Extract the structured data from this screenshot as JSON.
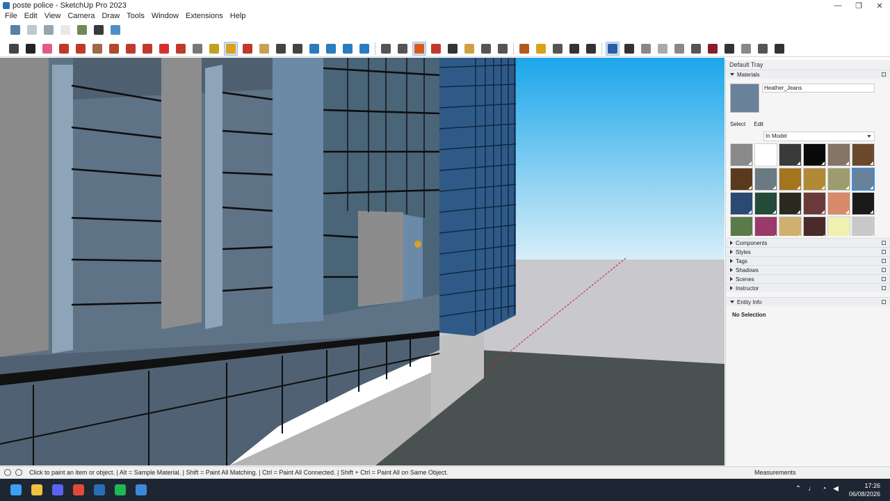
{
  "window": {
    "title": "poste police - SketchUp Pro 2023",
    "controls": [
      "—",
      "❐",
      "✕"
    ]
  },
  "menu": [
    "File",
    "Edit",
    "View",
    "Camera",
    "Draw",
    "Tools",
    "Window",
    "Extensions",
    "Help"
  ],
  "toolbar1": [
    {
      "name": "iso-view-icon",
      "color": "#5a7fa8"
    },
    {
      "name": "wireframe-style-icon",
      "color": "#bfc7cf"
    },
    {
      "name": "hidden-line-style-icon",
      "color": "#9aa4ad"
    },
    {
      "name": "shaded-style-icon",
      "color": "#e8e8e8"
    },
    {
      "name": "textured-style-icon",
      "color": "#6f8a52"
    },
    {
      "name": "monochrome-style-icon",
      "color": "#3a3a3a"
    },
    {
      "name": "xray-style-icon",
      "color": "#4d8fc8"
    }
  ],
  "toolbar2": [
    {
      "name": "zoom-extents-icon",
      "color": "#444"
    },
    {
      "name": "select-tool-icon",
      "color": "#222"
    },
    {
      "name": "eraser-tool-icon",
      "color": "#e05a8a"
    },
    {
      "name": "line-tool-icon",
      "color": "#c0392b"
    },
    {
      "name": "arc-tool-icon",
      "color": "#c0392b"
    },
    {
      "name": "rectangle-tool-icon",
      "color": "#a06a4a"
    },
    {
      "name": "push-pull-tool-icon",
      "color": "#b04a2a"
    },
    {
      "name": "offset-tool-icon",
      "color": "#c0392b"
    },
    {
      "name": "move-tool-icon",
      "color": "#c0392b"
    },
    {
      "name": "rotate-tool-icon",
      "color": "#d43030"
    },
    {
      "name": "scale-tool-icon",
      "color": "#c0392b"
    },
    {
      "name": "follow-me-tool-icon",
      "color": "#777"
    },
    {
      "name": "tape-measure-icon",
      "color": "#c4a020"
    },
    {
      "name": "paint-bucket-icon",
      "color": "#d8a21c",
      "active": true
    },
    {
      "name": "orbit-tool-icon",
      "color": "#c0392b"
    },
    {
      "name": "pan-tool-icon",
      "color": "#c9a05a"
    },
    {
      "name": "zoom-tool-icon",
      "color": "#444"
    },
    {
      "name": "zoom-window-icon",
      "color": "#444"
    },
    {
      "name": "section-plane-icon",
      "color": "#2a7bbf"
    },
    {
      "name": "sandbox-icon",
      "color": "#2a7bbf"
    },
    {
      "name": "layers-icon",
      "color": "#2a7bbf"
    },
    {
      "name": "solid-tools-icon",
      "color": "#2a7bbf"
    },
    {
      "name": "account-icon",
      "color": "#555"
    },
    {
      "name": "warehouse-icon",
      "color": "#555"
    },
    {
      "name": "share-component-icon",
      "color": "#d85a1a",
      "active": true
    },
    {
      "name": "extension-warehouse-icon",
      "color": "#c0392b"
    },
    {
      "name": "add-location-icon",
      "color": "#333"
    },
    {
      "name": "photo-texture-icon",
      "color": "#d0a040"
    },
    {
      "name": "match-photo-icon",
      "color": "#555"
    },
    {
      "name": "trimble-connect-icon",
      "color": "#555"
    },
    {
      "name": "extension-manager-icon",
      "color": "#b05a20"
    },
    {
      "name": "folder-icon",
      "color": "#d8a21c"
    },
    {
      "name": "info-icon",
      "color": "#555"
    },
    {
      "name": "store-icon",
      "color": "#333"
    },
    {
      "name": "user-icon",
      "color": "#333"
    },
    {
      "name": "active-extension-icon",
      "color": "#2a5da8",
      "active": true
    },
    {
      "name": "play-icon",
      "color": "#333"
    },
    {
      "name": "stop-icon",
      "color": "#888"
    },
    {
      "name": "video-icon",
      "color": "#aaa"
    },
    {
      "name": "record-icon",
      "color": "#888"
    },
    {
      "name": "settings-icon",
      "color": "#555"
    },
    {
      "name": "plugin-icon",
      "color": "#8a1c2e"
    },
    {
      "name": "lightning-icon",
      "color": "#333"
    },
    {
      "name": "close-circle-icon",
      "color": "#888"
    },
    {
      "name": "bulb-icon",
      "color": "#555"
    },
    {
      "name": "pen-icon",
      "color": "#333"
    }
  ],
  "tray": {
    "title": "Default Tray",
    "materials_label": "Materials",
    "material_name": "Heather_Jeans",
    "material_color": "#6a8299",
    "tabs": [
      "Select",
      "Edit"
    ],
    "library": "In Model",
    "swatches": [
      "#8a8a8a",
      "#ffffff",
      "#3a3a3a",
      "#0a0a0a",
      "#857566",
      "#6b4a2c",
      "#5a3a1c",
      "#6b7a82",
      "#a4741f",
      "#b08a34",
      "#9e9c6e",
      "#6a8299",
      "#2a4a72",
      "#244a3a",
      "#2a2a20",
      "#6a3a3a",
      "#d88a6a",
      "#1a1a1a",
      "#5a7a4a",
      "#9a3a6a",
      "#d0b070",
      "#4a2a2a",
      "#f0f0b0",
      "#c8c8c8"
    ],
    "sections": [
      "Components",
      "Styles",
      "Tags",
      "Shadows",
      "Scenes",
      "Instructor"
    ],
    "entity_info": "Entity Info",
    "no_selection": "No Selection"
  },
  "status": {
    "hint": "Click to paint an item or object. | Alt = Sample Material. | Shift = Paint All Matching. | Ctrl = Paint All Connected. | Shift + Ctrl = Paint All on Same Object.",
    "measurements": "Measurements"
  },
  "taskbar": {
    "apps": [
      {
        "name": "windows-start-icon",
        "color": "#3aa0f0"
      },
      {
        "name": "file-explorer-icon",
        "color": "#f0c040"
      },
      {
        "name": "discord-icon",
        "color": "#5865f2"
      },
      {
        "name": "chrome-icon",
        "color": "#e04a3a"
      },
      {
        "name": "sketchup-app-icon",
        "color": "#2a6fb5"
      },
      {
        "name": "spotify-icon",
        "color": "#1db954"
      },
      {
        "name": "sketchup-active-icon",
        "color": "#3a8ad8"
      }
    ],
    "time": "17:26",
    "date": "06/08/2026"
  }
}
